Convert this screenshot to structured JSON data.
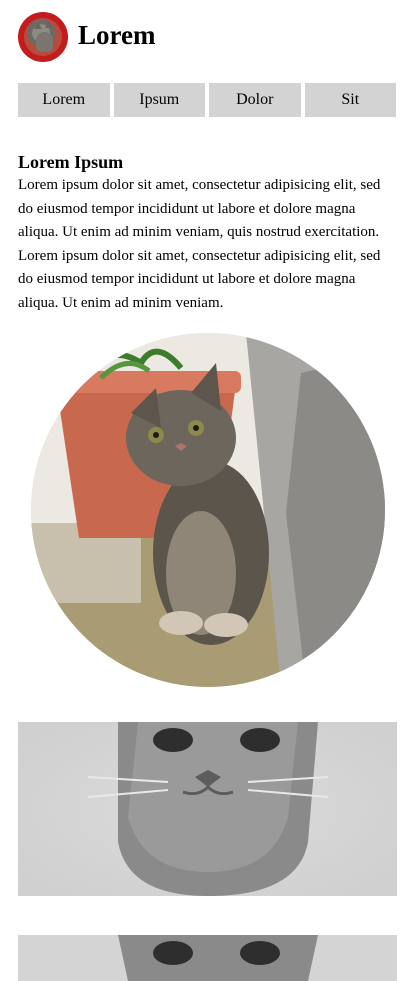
{
  "header": {
    "title": "Lorem"
  },
  "nav": {
    "items": [
      "Lorem",
      "Ipsum",
      "Dolor",
      "Sit"
    ]
  },
  "article": {
    "title": "Lorem Ipsum",
    "body": "Lorem ipsum dolor sit amet, consectetur adipisicing elit, sed do eiusmod tempor incididunt ut labore et dolore magna aliqua. Ut enim ad minim veniam, quis nostrud exercitation. Lorem ipsum dolor sit amet, consectetur adipisicing elit, sed do eiusmod tempor incididunt ut labore et dolore magna aliqua. Ut enim ad minim veniam."
  },
  "images": {
    "avatar": "kitten-avatar",
    "circle_photo": "kitten-by-flowerpot-photo",
    "banners": [
      "grayscale-kitten-face-photo",
      "grayscale-kitten-face-photo"
    ]
  }
}
